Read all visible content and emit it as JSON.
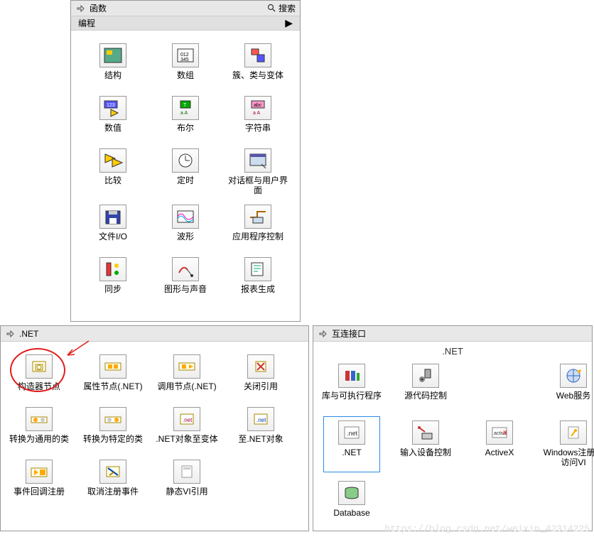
{
  "functions": {
    "title": "函数",
    "search": "搜索",
    "category": "编程",
    "items": [
      {
        "label": "结构",
        "icon": "structure"
      },
      {
        "label": "数组",
        "icon": "array"
      },
      {
        "label": "簇、类与变体",
        "icon": "cluster"
      },
      {
        "label": "数值",
        "icon": "numeric"
      },
      {
        "label": "布尔",
        "icon": "boolean"
      },
      {
        "label": "字符串",
        "icon": "string"
      },
      {
        "label": "比较",
        "icon": "compare"
      },
      {
        "label": "定时",
        "icon": "timing"
      },
      {
        "label": "对话框与用户界面",
        "icon": "dialog"
      },
      {
        "label": "文件I/O",
        "icon": "fileio"
      },
      {
        "label": "波形",
        "icon": "waveform"
      },
      {
        "label": "应用程序控制",
        "icon": "appcontrol"
      },
      {
        "label": "同步",
        "icon": "sync"
      },
      {
        "label": "图形与声音",
        "icon": "graphics"
      },
      {
        "label": "报表生成",
        "icon": "report"
      }
    ]
  },
  "net": {
    "title": ".NET",
    "items": [
      {
        "label": "构造器节点",
        "icon": "constructor"
      },
      {
        "label": "属性节点(.NET)",
        "icon": "propnode"
      },
      {
        "label": "调用节点(.NET)",
        "icon": "invokenode"
      },
      {
        "label": "关闭引用",
        "icon": "closeref"
      },
      {
        "label": "转换为通用的类",
        "icon": "togeneric"
      },
      {
        "label": "转换为特定的类",
        "icon": "tospecific"
      },
      {
        "label": ".NET对象至变体",
        "icon": "tovariant"
      },
      {
        "label": "至.NET对象",
        "icon": "tonetobj"
      },
      {
        "label": "事件回调注册",
        "icon": "eventreg"
      },
      {
        "label": "取消注册事件",
        "icon": "unreg"
      },
      {
        "label": "静态VI引用",
        "icon": "staticvi"
      }
    ]
  },
  "interconnect": {
    "title": "互连接口",
    "section": ".NET",
    "items": [
      {
        "label": "库与可执行程序",
        "icon": "libs"
      },
      {
        "label": "源代码控制",
        "icon": "scc"
      },
      {
        "label": "",
        "icon": ""
      },
      {
        "label": "Web服务",
        "icon": "web"
      },
      {
        "label": ".NET",
        "icon": "dotnet",
        "selected": true
      },
      {
        "label": "输入设备控制",
        "icon": "input"
      },
      {
        "label": "ActiveX",
        "icon": "activex"
      },
      {
        "label": "Windows注册表访问VI",
        "icon": "registry"
      },
      {
        "label": "Database",
        "icon": "database"
      }
    ]
  },
  "watermark": "https://blog.csdn.net/weixin_42314225"
}
